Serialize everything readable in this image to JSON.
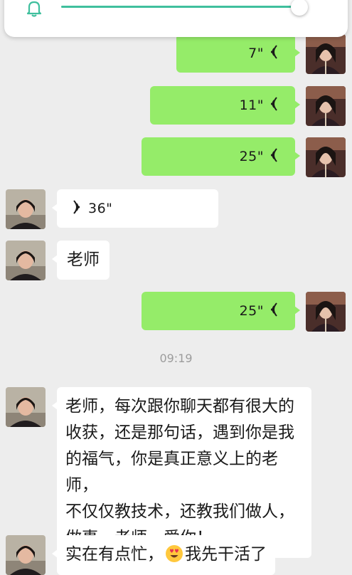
{
  "colors": {
    "my_bubble": "#95ec69",
    "their_bubble": "#ffffff",
    "background": "#ededed",
    "accent": "#3fbf9d"
  },
  "volume_panel": {
    "icon": "bell-icon",
    "level": 0.99
  },
  "messages": [
    {
      "sender": "me",
      "type": "voice",
      "duration": "7\""
    },
    {
      "sender": "me",
      "type": "voice",
      "duration": "11\""
    },
    {
      "sender": "me",
      "type": "voice",
      "duration": "25\""
    },
    {
      "sender": "them",
      "type": "voice",
      "duration": "36\""
    },
    {
      "sender": "them",
      "type": "text",
      "text": "老师"
    },
    {
      "sender": "me",
      "type": "voice",
      "duration": "25\""
    },
    {
      "type": "timestamp",
      "text": "09:19"
    },
    {
      "sender": "them",
      "type": "text",
      "lines": [
        "老师，每次跟你聊天都有很大的",
        "收获，还是那句话，遇到你是我",
        "的福气，你是真正意义上的老师，",
        "不仅仅教技术，还教我们做人，",
        "做事，老师，爱你！"
      ]
    },
    {
      "sender": "them",
      "type": "text",
      "text_before_emoji": "实在有点忙，",
      "emoji": "smiling-face-with-heart-eyes-emoji",
      "text_after_emoji": "我先干活了"
    }
  ]
}
